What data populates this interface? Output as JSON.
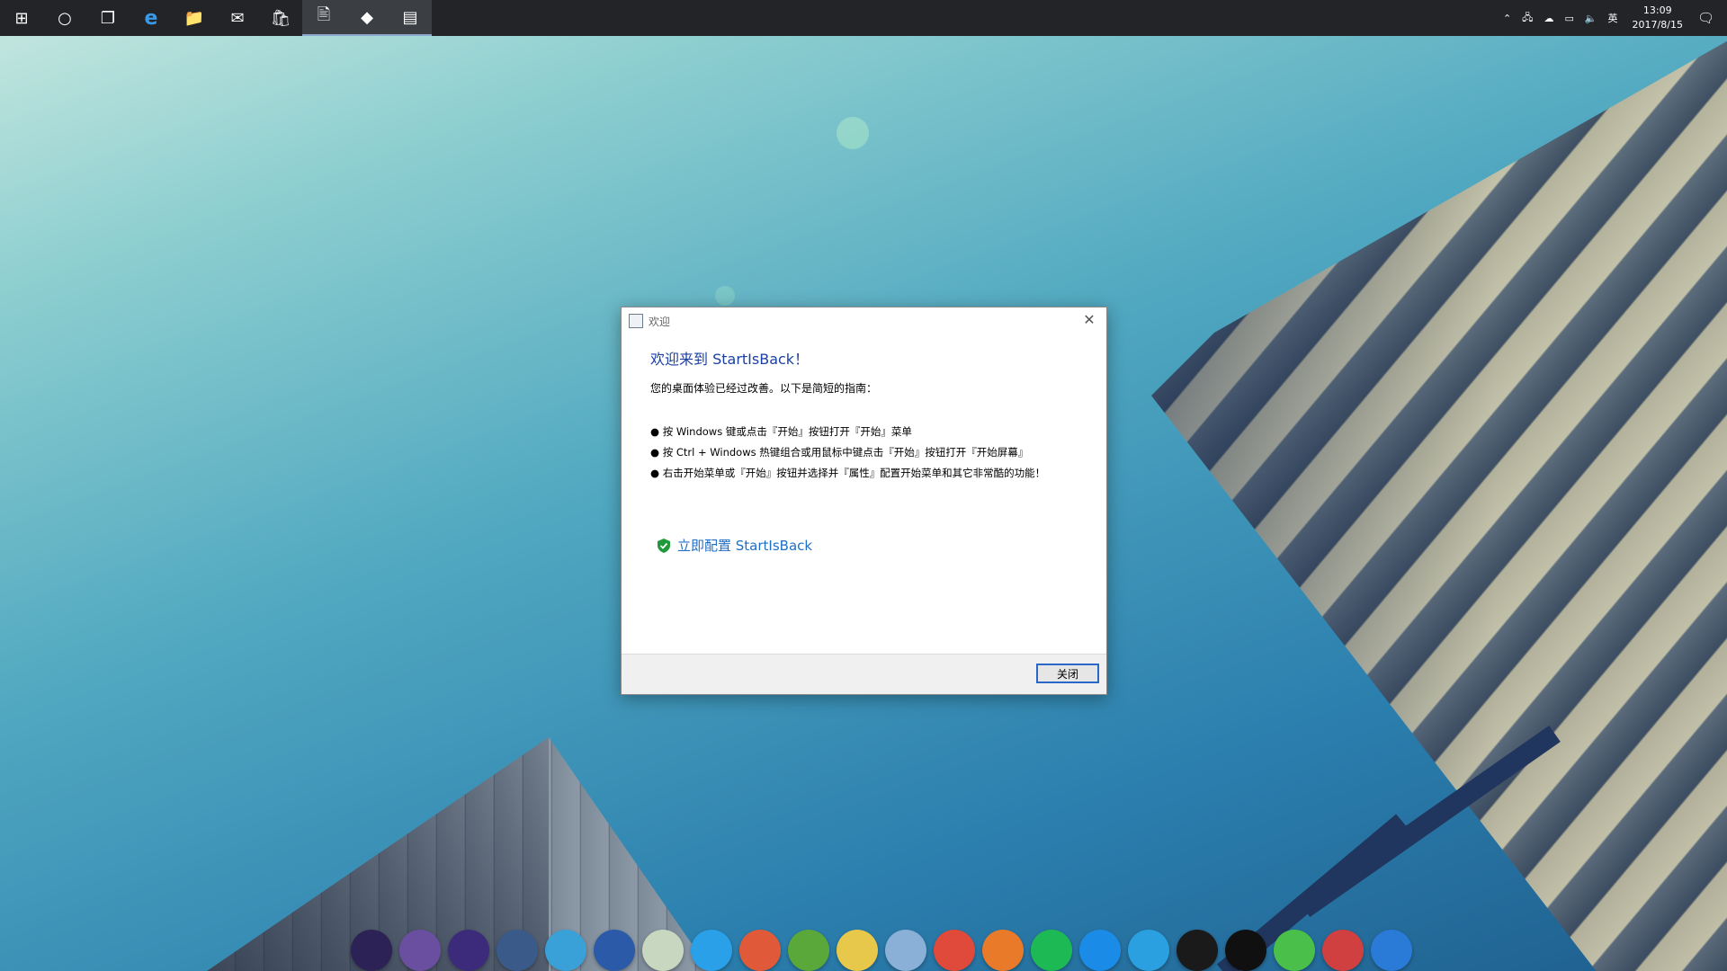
{
  "taskbar": {
    "pinned": [
      {
        "name": "start-button-icon",
        "glyph": "⊞"
      },
      {
        "name": "cortana-icon",
        "glyph": "○"
      },
      {
        "name": "task-view-icon",
        "glyph": "❐"
      },
      {
        "name": "edge-icon",
        "glyph": "e"
      },
      {
        "name": "file-explorer-icon",
        "glyph": "📁"
      },
      {
        "name": "mail-icon",
        "glyph": "✉"
      },
      {
        "name": "store-icon",
        "glyph": "🛍"
      },
      {
        "name": "notepad-app-icon",
        "glyph": "🖹"
      },
      {
        "name": "git-app-icon",
        "glyph": "◆"
      },
      {
        "name": "window-app-icon",
        "glyph": "▤"
      }
    ],
    "tray": {
      "ime": "英",
      "time": "13:09",
      "date": "2017/8/15"
    }
  },
  "dialog": {
    "title": "欢迎",
    "heading": "欢迎来到 StartIsBack！",
    "intro": "您的桌面体验已经过改善。以下是简短的指南：",
    "bullets": [
      "● 按 Windows 键或点击『开始』按钮打开『开始』菜单",
      "● 按 Ctrl + Windows 热键组合或用鼠标中键点击『开始』按钮打开『开始屏幕』",
      "● 右击开始菜单或『开始』按钮并选择并『属性』配置开始菜单和其它非常酷的功能！"
    ],
    "configure_link": "立即配置 StartIsBack",
    "close_button": "关闭"
  },
  "dock": {
    "items": [
      {
        "name": "eclipse-icon",
        "color": "#2c2255"
      },
      {
        "name": "eclipse-purple-icon",
        "color": "#6a4fa0"
      },
      {
        "name": "eclipse-che-icon",
        "color": "#3b2b7a"
      },
      {
        "name": "virtualbox-icon",
        "color": "#3a5a8a"
      },
      {
        "name": "teamviewer-icon",
        "color": "#3aa0d8"
      },
      {
        "name": "monitor-icon",
        "color": "#2a5aa8"
      },
      {
        "name": "recycle-bin-icon",
        "color": "#c8d8c0"
      },
      {
        "name": "feishu-icon",
        "color": "#2aa0e8"
      },
      {
        "name": "swift-icon",
        "color": "#e05a3a"
      },
      {
        "name": "money-icon",
        "color": "#5aa83a"
      },
      {
        "name": "duck-icon",
        "color": "#e8c84a"
      },
      {
        "name": "chromium-icon",
        "color": "#8ab0d8"
      },
      {
        "name": "chrome-icon",
        "color": "#e04a3a"
      },
      {
        "name": "firefox-icon",
        "color": "#e87a2a"
      },
      {
        "name": "spotify-icon",
        "color": "#1db954"
      },
      {
        "name": "dingtalk-icon",
        "color": "#1a8ce8"
      },
      {
        "name": "telegram-icon",
        "color": "#2aa0e0"
      },
      {
        "name": "intellij-icon",
        "color": "#1a1a1a"
      },
      {
        "name": "qq-icon",
        "color": "#101010"
      },
      {
        "name": "wechat-icon",
        "color": "#4ac04a"
      },
      {
        "name": "steam-icon",
        "color": "#d04040"
      },
      {
        "name": "tools-icon",
        "color": "#2a7ad8"
      }
    ]
  }
}
